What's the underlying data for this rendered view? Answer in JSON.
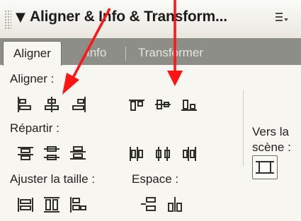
{
  "panel": {
    "title": "Aligner & Info & Transform...",
    "collapse_icon": "triangle-down-icon",
    "menu_icon": "panel-menu-icon"
  },
  "tabs": [
    {
      "label": "Aligner",
      "active": true
    },
    {
      "label": "Info",
      "active": false
    },
    {
      "label": "Transformer",
      "active": false
    }
  ],
  "sections": {
    "align": "Aligner :",
    "distribute": "Répartir :",
    "match_size": "Ajuster la taille :",
    "space": "Espace :",
    "to_stage": "Vers la\nscène :"
  },
  "colors": {
    "arrow": "#ff1414",
    "tab_bar": "#8e8e88",
    "panel_bg": "#f7f6f1"
  }
}
